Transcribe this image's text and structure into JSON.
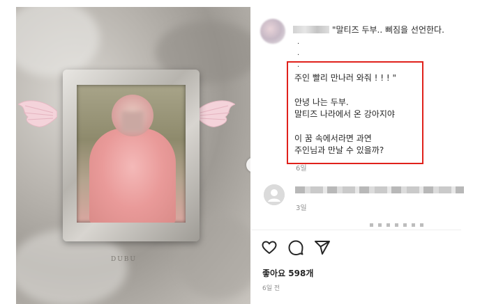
{
  "post_image": {
    "frame_caption": "DUBU",
    "next_icon": "chevron-right-icon"
  },
  "caption": {
    "first_line": "\"말티즈 두부.. 삐짐을 선언한다.",
    "dots": [
      ".",
      ".",
      "."
    ],
    "lines": [
      "주인 빨리 만나러 와줘 ! ! ! \"",
      "안녕 나는 두부.",
      "말티즈 나라에서 온 강아지야",
      "이 꿈 속에서라면 과연",
      "주인님과 만날 수 있을까?"
    ],
    "time": "6일"
  },
  "comment": {
    "time": "3일"
  },
  "actions": {
    "like_icon": "heart-icon",
    "comment_icon": "comment-icon",
    "share_icon": "send-icon"
  },
  "likes_text": "좋아요 598개",
  "date_text": "6일 전",
  "colors": {
    "highlight_border": "#e0211b",
    "secondary_text": "#8e8e8e"
  }
}
